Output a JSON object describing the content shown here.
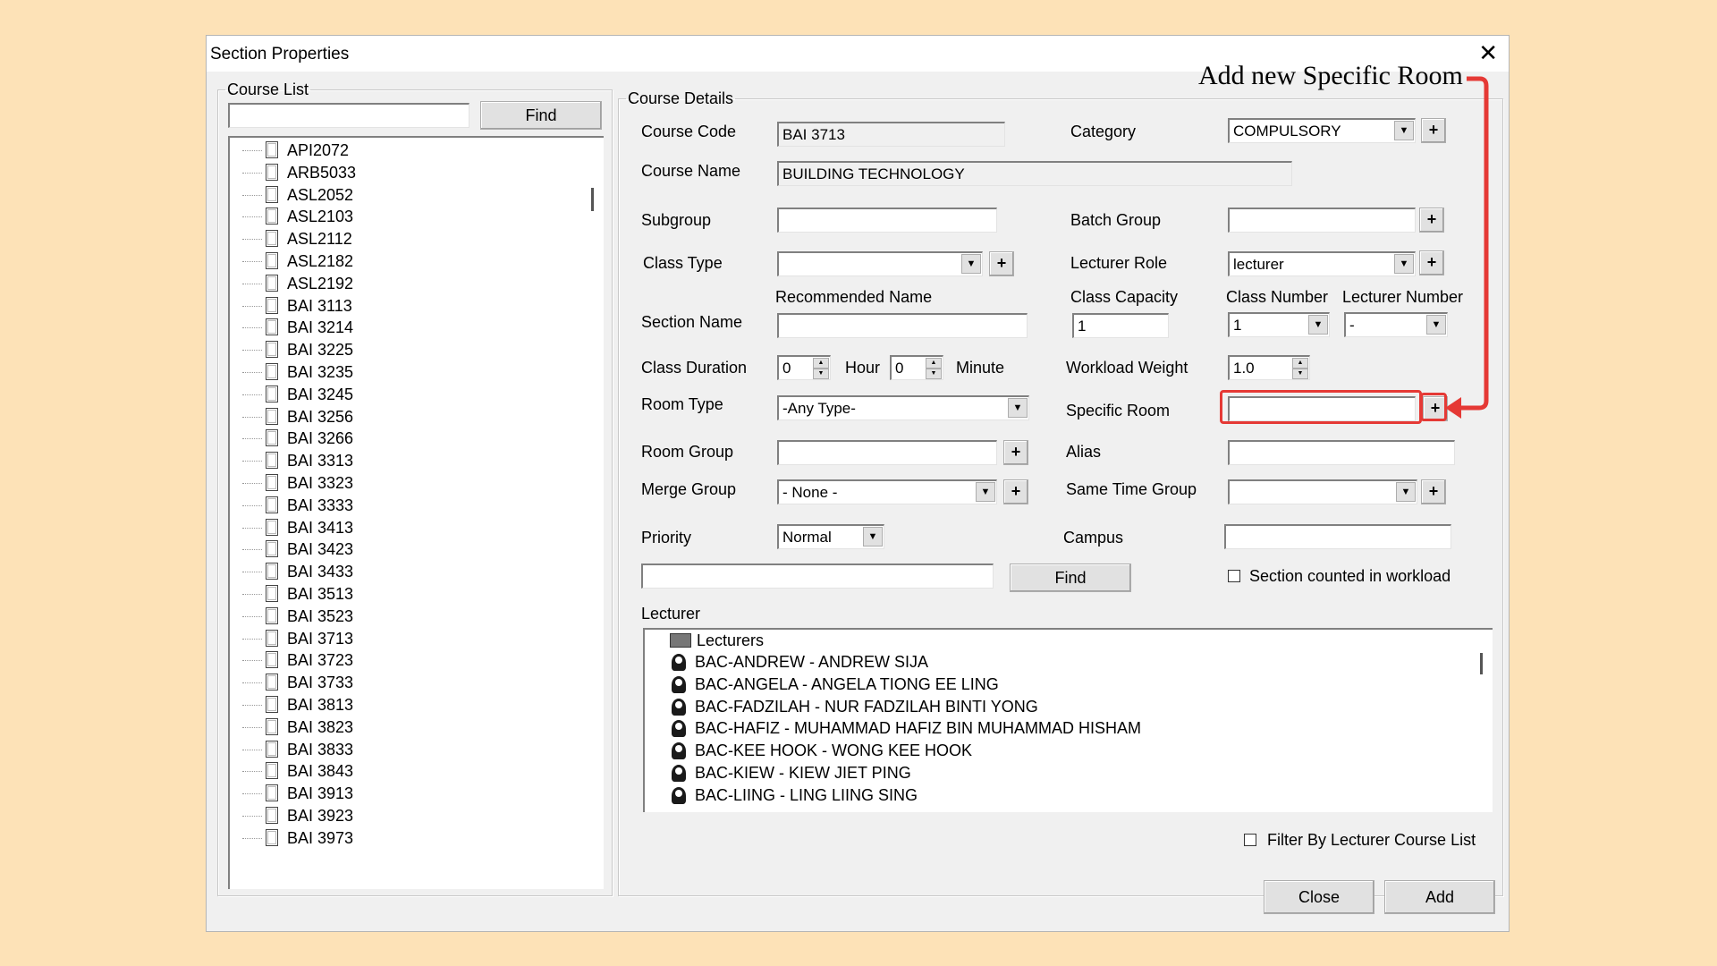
{
  "dialog": {
    "title": "Section Properties",
    "close_glyph": "✕"
  },
  "course_list": {
    "legend": "Course List",
    "search_value": "",
    "find_label": "Find",
    "items": [
      "API2072",
      "ARB5033",
      "ASL2052",
      "ASL2103",
      "ASL2112",
      "ASL2182",
      "ASL2192",
      "BAI 3113",
      "BAI 3214",
      "BAI 3225",
      "BAI 3235",
      "BAI 3245",
      "BAI 3256",
      "BAI 3266",
      "BAI 3313",
      "BAI 3323",
      "BAI 3333",
      "BAI 3413",
      "BAI 3423",
      "BAI 3433",
      "BAI 3513",
      "BAI 3523",
      "BAI 3713",
      "BAI 3723",
      "BAI 3733",
      "BAI 3813",
      "BAI 3823",
      "BAI 3833",
      "BAI 3843",
      "BAI 3913",
      "BAI 3923",
      "BAI 3973"
    ]
  },
  "details": {
    "legend": "Course Details",
    "course_code_label": "Course Code",
    "course_code": "BAI 3713",
    "category_label": "Category",
    "category": "COMPULSORY",
    "course_name_label": "Course Name",
    "course_name": "BUILDING TECHNOLOGY",
    "subgroup_label": "Subgroup",
    "subgroup": "",
    "batch_group_label": "Batch Group",
    "batch_group": "",
    "class_type_label": "Class Type",
    "class_type": "",
    "lecturer_role_label": "Lecturer Role",
    "lecturer_role": "lecturer",
    "recommended_name_label": "Recommended Name",
    "class_capacity_label": "Class Capacity",
    "class_capacity": "1",
    "class_number_label": "Class Number",
    "class_number": "1",
    "lecturer_number_label": "Lecturer Number",
    "lecturer_number": "-",
    "section_name_label": "Section Name",
    "section_name": "",
    "class_duration_label": "Class Duration",
    "duration_hour": "0",
    "hour_label": "Hour",
    "duration_minute": "0",
    "minute_label": "Minute",
    "workload_weight_label": "Workload Weight",
    "workload_weight": "1.0",
    "room_type_label": "Room Type",
    "room_type": "-Any Type-",
    "specific_room_label": "Specific Room",
    "specific_room": "",
    "room_group_label": "Room Group",
    "room_group": "",
    "alias_label": "Alias",
    "alias": "",
    "merge_group_label": "Merge Group",
    "merge_group": "- None -",
    "same_time_group_label": "Same Time Group",
    "same_time_group": "",
    "priority_label": "Priority",
    "priority": "Normal",
    "campus_label": "Campus",
    "campus": "",
    "lecturer_search": "",
    "find_label": "Find",
    "section_counted_label": "Section counted in workload",
    "section_counted": false,
    "lecturer_label": "Lecturer",
    "lecturer_root": "Lecturers",
    "lecturers": [
      "BAC-ANDREW - ANDREW SIJA",
      "BAC-ANGELA - ANGELA TIONG EE LING",
      "BAC-FADZILAH - NUR FADZILAH BINTI YONG",
      "BAC-HAFIZ - MUHAMMAD HAFIZ BIN MUHAMMAD HISHAM",
      "BAC-KEE HOOK - WONG KEE HOOK",
      "BAC-KIEW - KIEW JIET PING",
      "BAC-LIING - LING LIING SING"
    ],
    "filter_label": "Filter By Lecturer Course List",
    "filter_checked": false
  },
  "footer": {
    "close_label": "Close",
    "add_label": "Add"
  },
  "annotation": {
    "text": "Add new Specific Room",
    "color": "#e53935"
  },
  "colors": {
    "background": "#fde2b7",
    "dialog": "#f0f0f0"
  }
}
